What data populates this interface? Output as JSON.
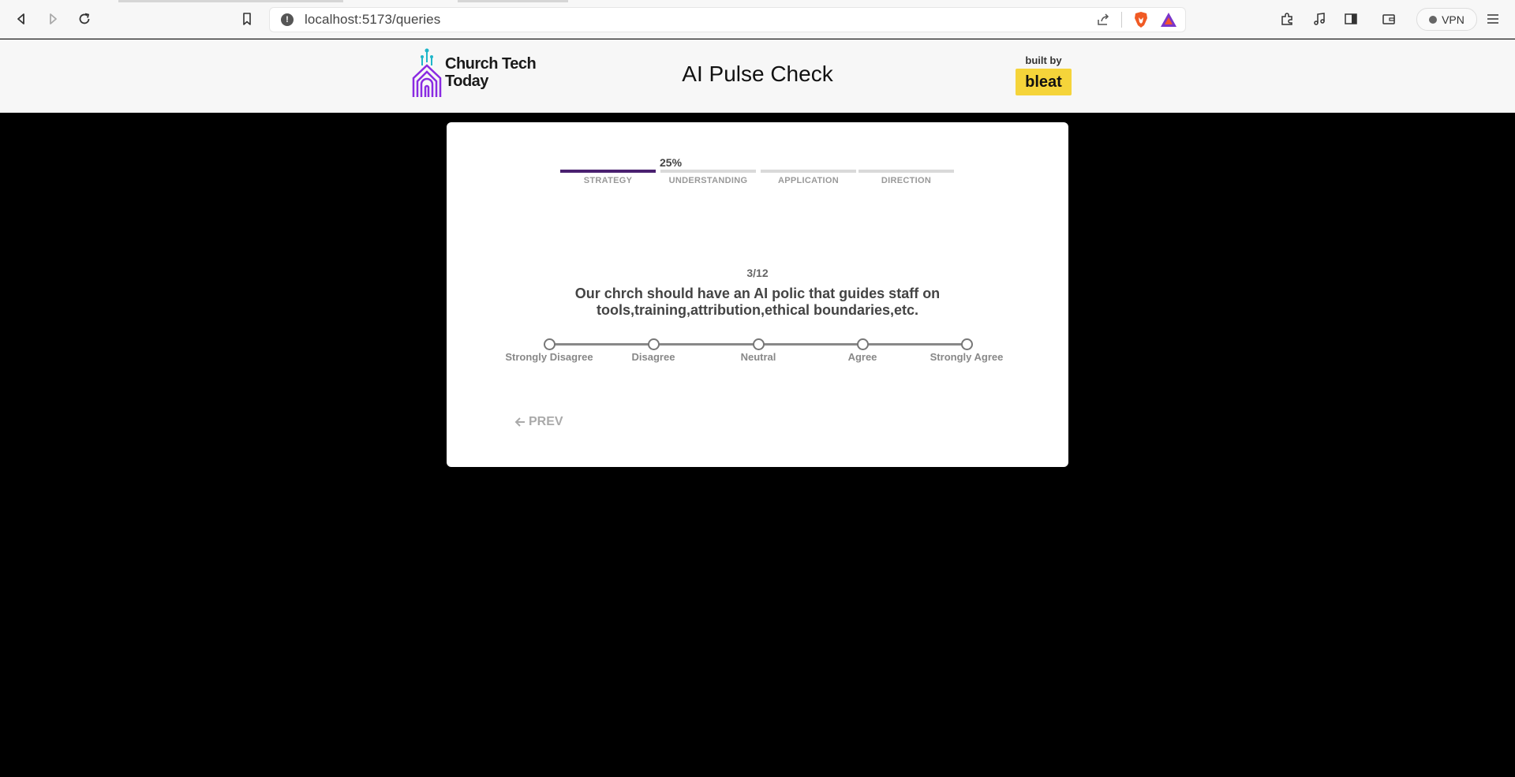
{
  "browser": {
    "url": "localhost:5173/queries",
    "vpn_label": "VPN"
  },
  "header": {
    "logo_line1": "Church Tech",
    "logo_line2": "Today",
    "title": "AI Pulse Check",
    "built_by_label": "built by",
    "built_by_brand": "bleat"
  },
  "progress": {
    "percent_label": "25%",
    "percent": 25,
    "sections": [
      {
        "label": "STRATEGY",
        "active": true
      },
      {
        "label": "UNDERSTANDING",
        "active": false
      },
      {
        "label": "APPLICATION",
        "active": false
      },
      {
        "label": "DIRECTION",
        "active": false
      }
    ]
  },
  "question": {
    "counter": "3/12",
    "text": "Our chrch should have an AI polic that guides staff on tools,training,attribution,ethical boundaries,etc."
  },
  "scale": {
    "options": [
      "Strongly Disagree",
      "Disagree",
      "Neutral",
      "Agree",
      "Strongly Agree"
    ]
  },
  "nav": {
    "prev_label": "PREV"
  },
  "colors": {
    "accent": "#4a2070",
    "brand_yellow": "#f5d43a"
  }
}
